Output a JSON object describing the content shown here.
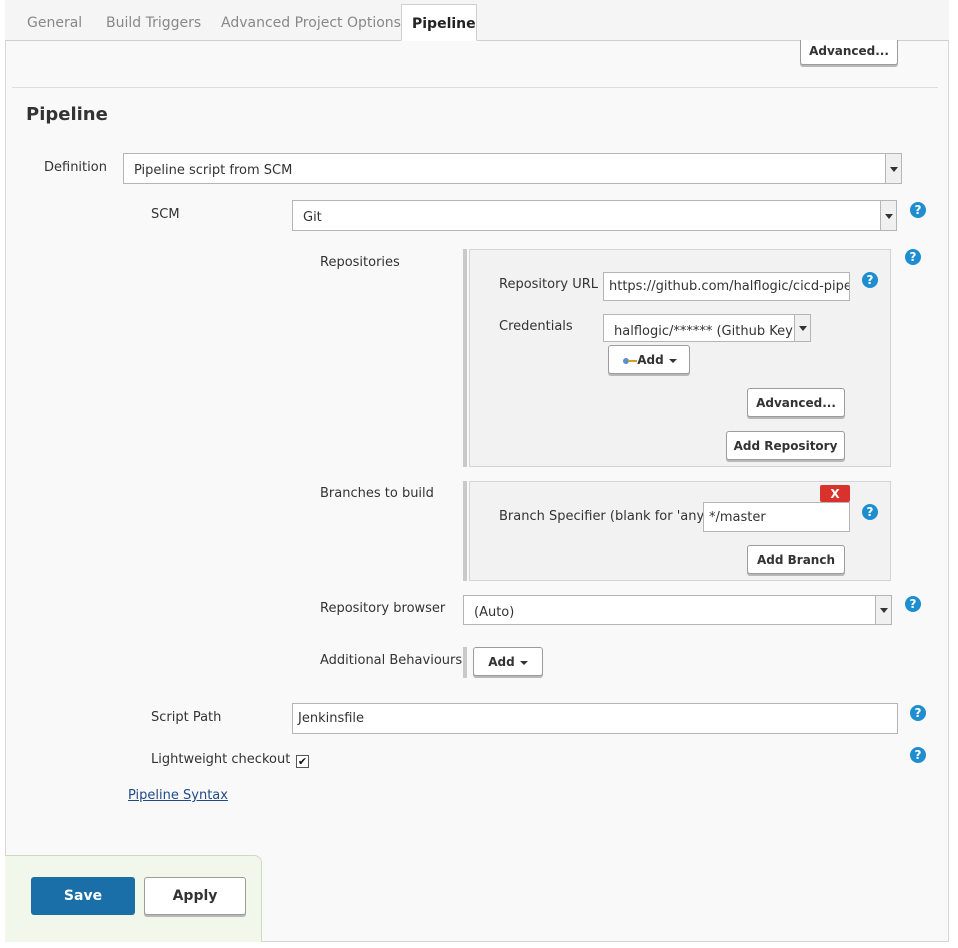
{
  "tabs": [
    {
      "label": "General"
    },
    {
      "label": "Build Triggers"
    },
    {
      "label": "Advanced Project Options"
    },
    {
      "label": "Pipeline"
    }
  ],
  "top_advanced_label": "Advanced...",
  "section_title": "Pipeline",
  "definition": {
    "label": "Definition",
    "value": "Pipeline script from SCM"
  },
  "scm": {
    "label": "SCM",
    "value": "Git"
  },
  "repositories": {
    "label": "Repositories",
    "url_label": "Repository URL",
    "url_value": "https://github.com/halflogic/cicd-pipeli",
    "credentials_label": "Credentials",
    "credentials_value": "halflogic/****** (Github Key)",
    "add_label": "Add",
    "advanced_label": "Advanced...",
    "add_repository_label": "Add Repository"
  },
  "branches": {
    "label": "Branches to build",
    "delete_label": "X",
    "specifier_label": "Branch Specifier (blank for 'any')",
    "specifier_value": "*/master",
    "add_branch_label": "Add Branch"
  },
  "repository_browser": {
    "label": "Repository browser",
    "value": "(Auto)"
  },
  "additional_behaviours": {
    "label": "Additional Behaviours",
    "add_label": "Add"
  },
  "script_path": {
    "label": "Script Path",
    "value": "Jenkinsfile"
  },
  "lightweight_checkout": {
    "label": "Lightweight checkout",
    "checked": true
  },
  "pipeline_syntax_link": "Pipeline Syntax",
  "footer": {
    "save_label": "Save",
    "apply_label": "Apply"
  },
  "help_glyph": "?",
  "checkmark_glyph": "✔",
  "colors": {
    "primary": "#1a6fa8",
    "help": "#1e8ed1",
    "danger": "#d9322c",
    "footer_bg": "#f1f7ea"
  }
}
